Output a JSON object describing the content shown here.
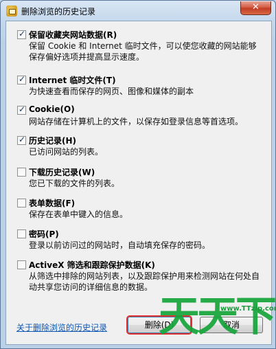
{
  "window": {
    "title": "删除浏览的历史记录",
    "close_label": "✕"
  },
  "options": [
    {
      "checked": true,
      "title": "保留收藏夹网站数据(R)",
      "desc": "保留 Cookie 和 Internet 临时文件，可以使您收藏的网站能够保存偏好选项并提高显示速度。"
    },
    {
      "checked": true,
      "title": "Internet 临时文件(T)",
      "desc": "为快速查看而保存的网页、图像和媒体的副本"
    },
    {
      "checked": true,
      "title": "Cookie(O)",
      "desc": "网站存储在计算机上的文件，以保存如登录信息等首选项。"
    },
    {
      "checked": true,
      "title": "历史记录(H)",
      "desc": "已访问网站的列表。"
    },
    {
      "checked": false,
      "title": "下载历史记录(W)",
      "desc": "您已下载的文件的列表。"
    },
    {
      "checked": false,
      "title": "表单数据(F)",
      "desc": "保存在表单中键入的信息。"
    },
    {
      "checked": false,
      "title": "密码(P)",
      "desc": "登录以前访问过的网站时，自动填充保存的密码。"
    },
    {
      "checked": false,
      "title": "ActiveX 筛选和跟踪保护数据(K)",
      "desc": "从筛选中排除的网站列表，以及跟踪保护用来检测网站在何处自动共享您访问的详细信息的数据。"
    }
  ],
  "footer": {
    "link": "关于删除浏览的历史记录",
    "delete_button": "删除(D)",
    "cancel_button": "取消"
  },
  "watermark": {
    "url": "www.TTzip.com",
    "text": "天天下载"
  }
}
